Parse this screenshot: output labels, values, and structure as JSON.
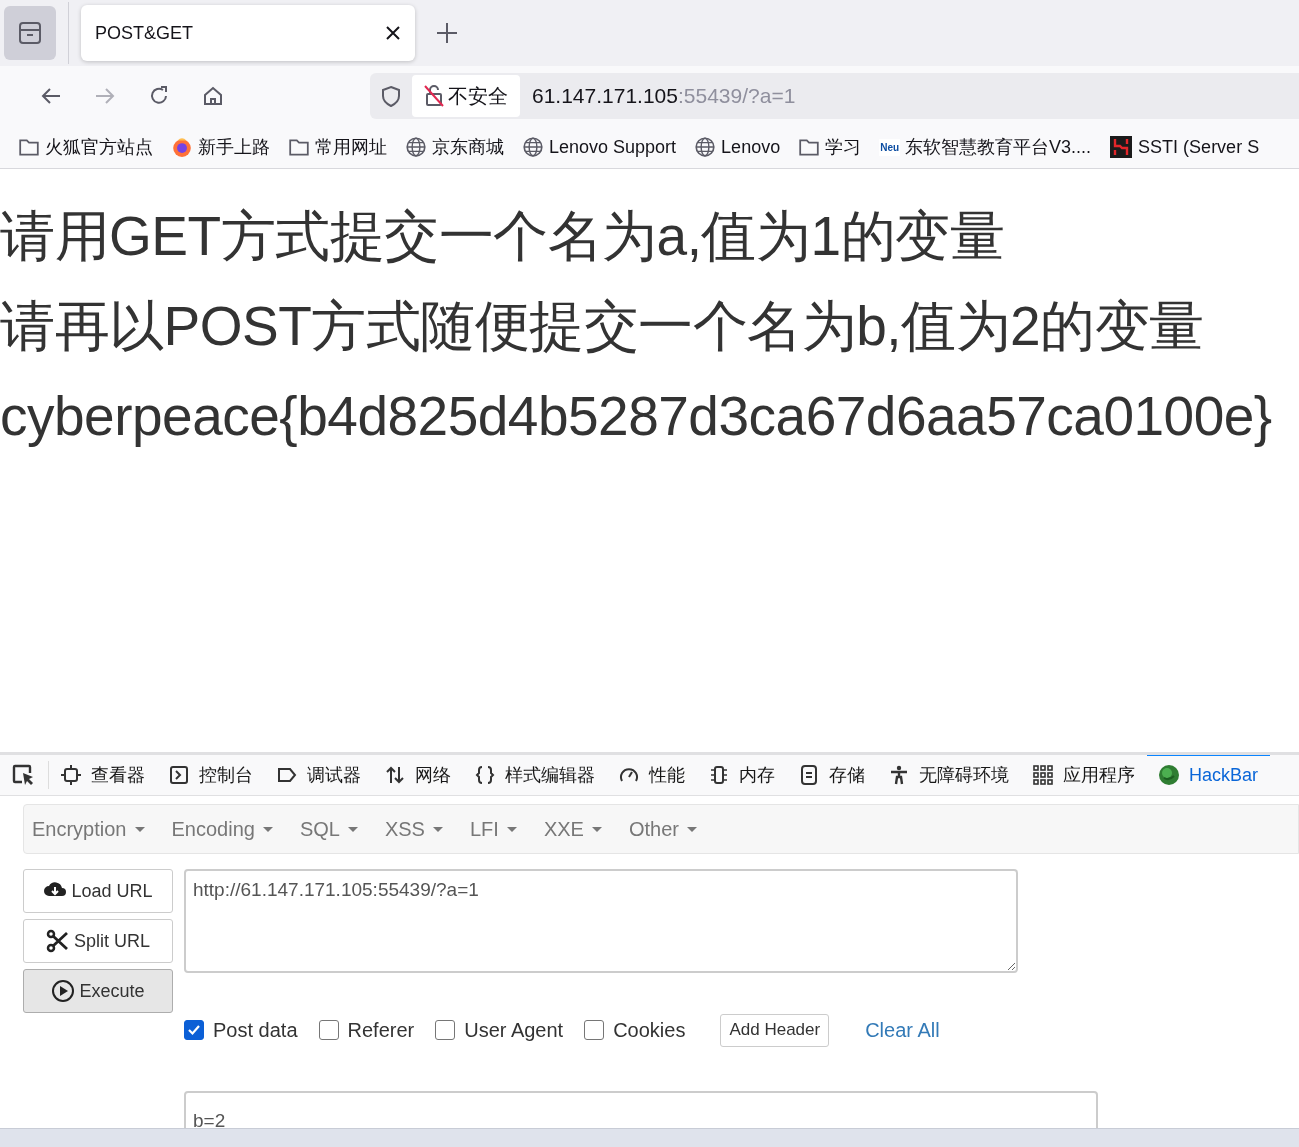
{
  "browser_tab": {
    "title": "POST&GET",
    "selected": true
  },
  "address_bar": {
    "security_label": "不安全",
    "url_host": "61.147.171.105",
    "url_rest": ":55439/?a=1"
  },
  "bookmarks": [
    {
      "label": "火狐官方站点",
      "kind": "folder"
    },
    {
      "label": "新手上路",
      "kind": "firefox"
    },
    {
      "label": "常用网址",
      "kind": "folder"
    },
    {
      "label": "京东商城",
      "kind": "globe"
    },
    {
      "label": "Lenovo Support",
      "kind": "globe"
    },
    {
      "label": "Lenovo",
      "kind": "globe"
    },
    {
      "label": "学习",
      "kind": "folder"
    },
    {
      "label": "东软智慧教育平台V3....",
      "kind": "neu",
      "badge": "Neu"
    },
    {
      "label": "SSTI (Server S",
      "kind": "ssti"
    }
  ],
  "page_lines": [
    "请用GET方式提交一个名为a,值为1的变量",
    "请再以POST方式随便提交一个名为b,值为2的变量",
    "cyberpeace{b4d825d4b5287d3ca67d6aa57ca0100e}"
  ],
  "devtools_tabs": [
    {
      "label": "查看器",
      "kind": "inspector",
      "selected": false
    },
    {
      "label": "控制台",
      "kind": "console",
      "selected": false
    },
    {
      "label": "调试器",
      "kind": "debugger",
      "selected": false
    },
    {
      "label": "网络",
      "kind": "network",
      "selected": false
    },
    {
      "label": "样式编辑器",
      "kind": "style",
      "selected": false
    },
    {
      "label": "性能",
      "kind": "performance",
      "selected": false
    },
    {
      "label": "内存",
      "kind": "memory",
      "selected": false
    },
    {
      "label": "存储",
      "kind": "storage",
      "selected": false
    },
    {
      "label": "无障碍环境",
      "kind": "accessibility",
      "selected": false
    },
    {
      "label": "应用程序",
      "kind": "application",
      "selected": false
    },
    {
      "label": "HackBar",
      "kind": "hackbar",
      "selected": true
    }
  ],
  "hackbar": {
    "menus": [
      "Encryption",
      "Encoding",
      "SQL",
      "XSS",
      "LFI",
      "XXE",
      "Other"
    ],
    "buttons": [
      {
        "label": "Load URL",
        "kind": "load"
      },
      {
        "label": "Split URL",
        "kind": "split"
      },
      {
        "label": "Execute",
        "kind": "execute"
      }
    ],
    "url": "http://61.147.171.105:55439/?a=1",
    "options": [
      {
        "label": "Post data",
        "checked": true
      },
      {
        "label": "Referer",
        "checked": false
      },
      {
        "label": "User Agent",
        "checked": false
      },
      {
        "label": "Cookies",
        "checked": false
      }
    ],
    "add_header": "Add Header",
    "clear_all": "Clear All",
    "post_body": "b=2"
  }
}
